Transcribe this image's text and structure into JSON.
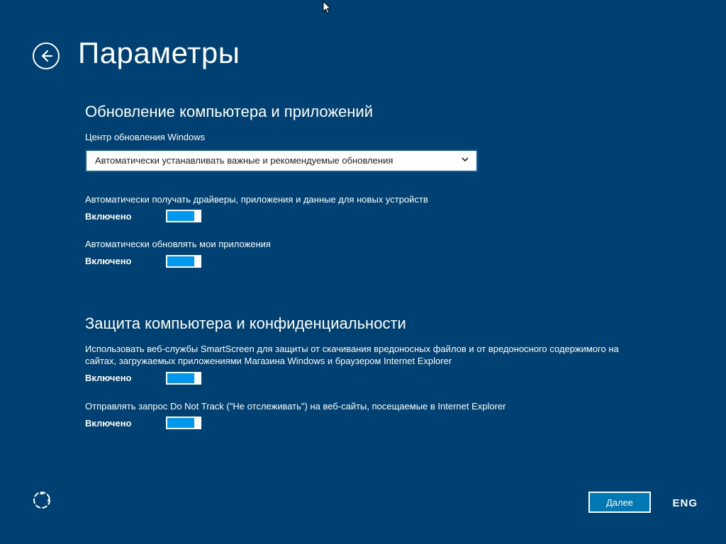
{
  "title": "Параметры",
  "section1": {
    "heading": "Обновление компьютера и приложений",
    "wu_label": "Центр обновления Windows",
    "wu_selected": "Автоматически устанавливать важные и рекомендуемые обновления",
    "opt1": {
      "text": "Автоматически получать драйверы, приложения и данные для новых устройств",
      "state": "Включено"
    },
    "opt2": {
      "text": "Автоматически обновлять мои приложения",
      "state": "Включено"
    }
  },
  "section2": {
    "heading": "Защита компьютера и конфиденциальности",
    "opt1": {
      "text": "Использовать веб-службы SmartScreen для защиты от скачивания вредоносных файлов и от вредоносного содержимого на сайтах, загружаемых приложениями Магазина Windows и браузером Internet Explorer",
      "state": "Включено"
    },
    "opt2": {
      "text": "Отправлять запрос Do Not Track (\"Не отслеживать\") на веб-сайты, посещаемые в Internet Explorer",
      "state": "Включено"
    }
  },
  "footer": {
    "next": "Далее",
    "lang": "ENG"
  }
}
